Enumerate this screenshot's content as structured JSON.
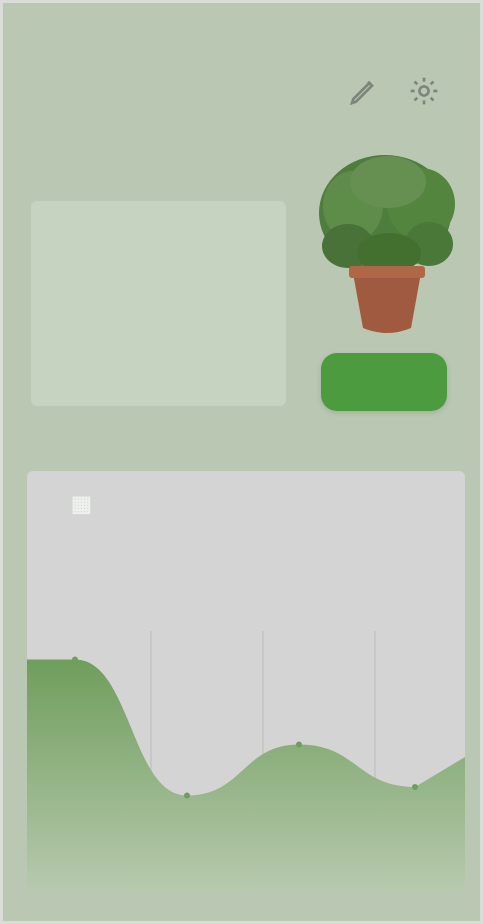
{
  "header": {
    "title": "",
    "edit_icon": "pencil-icon",
    "settings_icon": "settings-icon"
  },
  "stats": [
    {
      "label": "",
      "value": ""
    },
    {
      "label": "",
      "value": ""
    },
    {
      "label": "",
      "value": ""
    }
  ],
  "plant": {
    "image_icon": "potted-plant-icon"
  },
  "action_button": {
    "label": ""
  },
  "history_card": {
    "title": "",
    "title_icon": "chart-icon",
    "subtitle": "",
    "x_labels": [
      "",
      "",
      "",
      ""
    ],
    "chart_data": {
      "type": "area",
      "series": [
        {
          "values": [
            0.95,
            0.15,
            0.45,
            0.2
          ]
        }
      ]
    }
  },
  "colors": {
    "background": "#b9c7b3",
    "accent": "#4c9b3f",
    "card": "#d3d4d3"
  }
}
